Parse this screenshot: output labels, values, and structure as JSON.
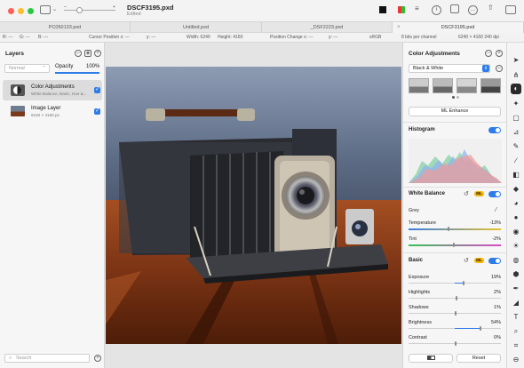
{
  "window": {
    "title": "DSCF3195.pxd",
    "subtitle": "Edited"
  },
  "tabs": [
    {
      "label": "PC050133.pxd"
    },
    {
      "label": "Untitled.pxd"
    },
    {
      "label": "_DSF2223.pxd"
    },
    {
      "label": "DSCF3195.pxd"
    }
  ],
  "infobar": {
    "r": "R: ---",
    "g": "G: ---",
    "b": "B: ---",
    "cursor_x": "Cursor Position x: ---",
    "cursor_y": "y: ---",
    "width": "Width: 6240",
    "height": "Height: 4160",
    "pos_x": "Position Change x: ---",
    "pos_y": "y: ---",
    "colorspace": "sRGB",
    "bits": "8 bits per channel",
    "size": "6240 × 4160 240 dpi"
  },
  "layers_panel": {
    "title": "Layers",
    "blend_mode": "Normal",
    "opacity_label": "Opacity",
    "opacity_value": "100%",
    "layers": [
      {
        "name": "Color Adjustments",
        "sub": "White Balance, Basic, Hue &..."
      },
      {
        "name": "Image Layer",
        "sub": "6240 × 4160 px"
      }
    ],
    "search_placeholder": "Search"
  },
  "adjust_panel": {
    "title": "Color Adjustments",
    "preset": "Black & White",
    "ml_enhance": "ML Enhance",
    "histogram": "Histogram",
    "white_balance": "White Balance",
    "grey": "Grey",
    "temperature": {
      "label": "Temperature",
      "value": "-13%"
    },
    "tint": {
      "label": "Tint",
      "value": "-2%"
    },
    "basic": "Basic",
    "ml": "ML",
    "basic_adjustments": [
      {
        "label": "Exposure",
        "value": "19%"
      },
      {
        "label": "Highlights",
        "value": "2%"
      },
      {
        "label": "Shadows",
        "value": "1%"
      },
      {
        "label": "Brightness",
        "value": "54%"
      },
      {
        "label": "Contrast",
        "value": "0%"
      }
    ],
    "reset": "Reset"
  },
  "colors": {
    "accent": "#2d7ce8",
    "ml_badge": "#f4b400"
  }
}
